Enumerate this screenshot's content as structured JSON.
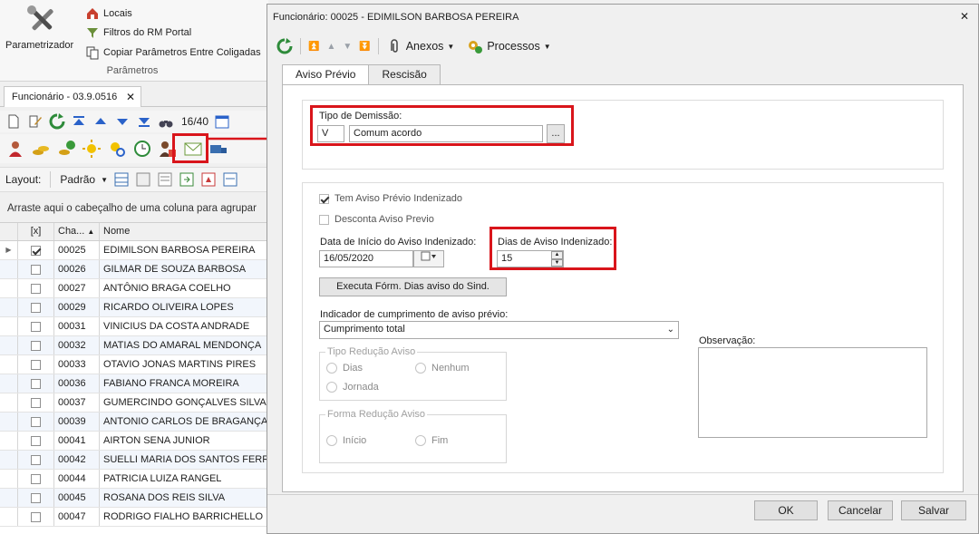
{
  "ribbon": {
    "main_button": "Parametrizador",
    "items": [
      "Locais",
      "Filtros do RM Portal",
      "Copiar Parâmetros Entre Coligadas"
    ],
    "group_caption": "Parâmetros"
  },
  "doc_tab": {
    "label": "Funcionário - 03.9.0516"
  },
  "toolbar": {
    "record_count": "16/40"
  },
  "layout_bar": {
    "label": "Layout:",
    "value": "Padrão"
  },
  "group_hint": "Arraste aqui o cabeçalho de uma coluna para agrupar",
  "grid": {
    "headers": {
      "check": "[x]",
      "code": "Cha...",
      "name": "Nome"
    },
    "rows": [
      {
        "code": "00025",
        "name": "EDIMILSON BARBOSA PEREIRA",
        "checked": true
      },
      {
        "code": "00026",
        "name": "GILMAR DE SOUZA BARBOSA"
      },
      {
        "code": "00027",
        "name": "ANTÔNIO BRAGA COELHO"
      },
      {
        "code": "00029",
        "name": "RICARDO OLIVEIRA LOPES"
      },
      {
        "code": "00031",
        "name": "VINICIUS DA COSTA ANDRADE"
      },
      {
        "code": "00032",
        "name": "MATIAS DO AMARAL MENDONÇA"
      },
      {
        "code": "00033",
        "name": "OTAVIO JONAS MARTINS PIRES"
      },
      {
        "code": "00036",
        "name": "FABIANO FRANCA MOREIRA"
      },
      {
        "code": "00037",
        "name": "GUMERCINDO GONÇALVES SILVA"
      },
      {
        "code": "00039",
        "name": "ANTONIO CARLOS DE BRAGANÇA"
      },
      {
        "code": "00041",
        "name": "AIRTON SENA JUNIOR"
      },
      {
        "code": "00042",
        "name": "SUELLI MARIA DOS SANTOS FERREIRA"
      },
      {
        "code": "00044",
        "name": "PATRICIA LUIZA RANGEL"
      },
      {
        "code": "00045",
        "name": "ROSANA DOS REIS SILVA"
      },
      {
        "code": "00047",
        "name": "RODRIGO FIALHO BARRICHELLO"
      }
    ]
  },
  "dialog": {
    "title": "Funcionário: 00025 - EDIMILSON BARBOSA PEREIRA",
    "close": "✕",
    "menus": {
      "attachments": "Anexos",
      "processes": "Processos"
    },
    "tabs": [
      "Aviso Prévio",
      "Rescisão"
    ],
    "tipo_demissao": {
      "label": "Tipo de Demissão:",
      "code": "V",
      "desc": "Comum acordo",
      "lookup": "..."
    },
    "tem_aviso": "Tem Aviso Prévio Indenizado",
    "desconta_aviso": "Desconta Aviso Previo",
    "data_inicio": {
      "label": "Data de Início do Aviso Indenizado:",
      "value": "16/05/2020"
    },
    "dias_aviso": {
      "label": "Dias de Aviso Indenizado:",
      "value": "15"
    },
    "exec_button": "Executa Fórm. Dias aviso do Sind.",
    "indicador": {
      "label": "Indicador de cumprimento de aviso prévio:",
      "value": "Cumprimento total"
    },
    "observacao": "Observação:",
    "tipo_reducao": {
      "legend": "Tipo Redução Aviso",
      "opt1": "Dias",
      "opt2": "Nenhum",
      "opt3": "Jornada"
    },
    "forma_reducao": {
      "legend": "Forma Redução Aviso",
      "opt1": "Início",
      "opt2": "Fim"
    },
    "buttons": {
      "ok": "OK",
      "cancel": "Cancelar",
      "save": "Salvar"
    }
  },
  "colors": {
    "highlight": "#d9151b",
    "row_alt": "#f2f6fc"
  }
}
